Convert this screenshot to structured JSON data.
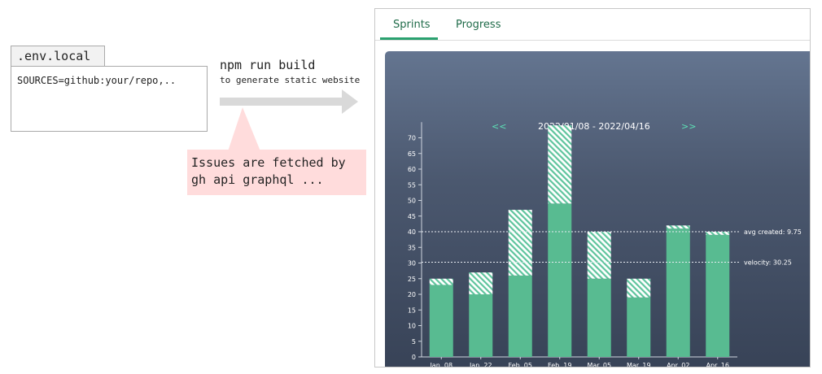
{
  "env": {
    "filename": ".env.local",
    "content": "SOURCES=github:your/repo,.."
  },
  "build": {
    "command": "npm run build",
    "description": "to generate static website"
  },
  "note": {
    "line1": "Issues are fetched by",
    "line2": "gh api graphql ..."
  },
  "app": {
    "tabs": [
      {
        "label": "Sprints",
        "active": true
      },
      {
        "label": "Progress",
        "active": false
      }
    ],
    "prev": "<<",
    "next": ">>",
    "date_range": "2022/01/08 - 2022/04/16"
  },
  "colors": {
    "completed": "#58bb91",
    "hatch": "#5ec49d",
    "accent": "#2aa16f",
    "note_bg": "#ffdcdc"
  },
  "chart_data": {
    "type": "bar",
    "stacked": true,
    "categories": [
      "Jan. 08",
      "Jan. 22",
      "Feb. 05",
      "Feb. 19",
      "Mar. 05",
      "Mar. 19",
      "Apr. 02",
      "Apr. 16"
    ],
    "series": [
      {
        "values": [
          23,
          20,
          26,
          49,
          25,
          19,
          41,
          39
        ]
      },
      {
        "values": [
          2,
          7,
          21,
          25,
          15,
          6,
          1,
          1
        ]
      }
    ],
    "ylim": [
      0,
      75
    ],
    "yticks": [
      0,
      5,
      10,
      15,
      20,
      25,
      30,
      35,
      40,
      45,
      50,
      55,
      60,
      65,
      70
    ],
    "reference_lines": [
      {
        "label": "avg created: 9.75",
        "value": 40
      },
      {
        "label": "velocity: 30.25",
        "value": 30.25
      }
    ]
  }
}
